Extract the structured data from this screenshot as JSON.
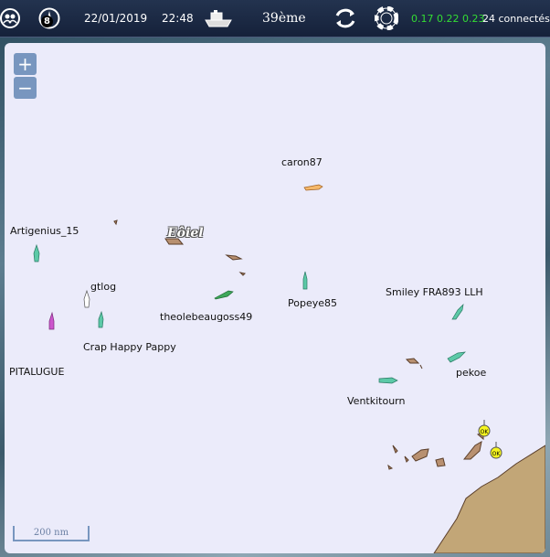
{
  "header": {
    "date": "22/01/2019",
    "time": "22:48",
    "rank": "39ème",
    "speeds": "0.17 0.22 0.23",
    "connected": "24 connectés",
    "badge_count": "8",
    "icons": [
      "people-icon",
      "compass-badge-icon",
      "boat-icon",
      "refresh-icon",
      "lifebuoy-icon"
    ],
    "colors": {
      "bar": "#1b2942",
      "speeds": "#33dd33"
    }
  },
  "map": {
    "zoom_in_label": "+",
    "zoom_out_label": "−",
    "scale_label": "200 nm",
    "island_label": "Eôiel",
    "land_color": "#c2a677",
    "sea_color": "#ebebfa",
    "boats": [
      {
        "name": "caron87",
        "color": "#f5b86a"
      },
      {
        "name": "Artigenius_15",
        "color": "#5cc9a7"
      },
      {
        "name": "gtlog",
        "color": "#ffffff"
      },
      {
        "name": "theolebeaugoss49",
        "color": "#3ea85a"
      },
      {
        "name": "Popeye85",
        "color": "#5cc9a7"
      },
      {
        "name": "Smiley FRA893 LLH",
        "color": "#5cc9a7"
      },
      {
        "name": "Crap Happy Pappy",
        "color": "#5cc9a7"
      },
      {
        "name": "PITALUGUE",
        "color": "#cc55cc"
      },
      {
        "name": "pekoe",
        "color": "#5cc9a7"
      },
      {
        "name": "Ventkitourn",
        "color": "#5cc9a7"
      }
    ],
    "markers": [
      "OK",
      "OK"
    ]
  }
}
